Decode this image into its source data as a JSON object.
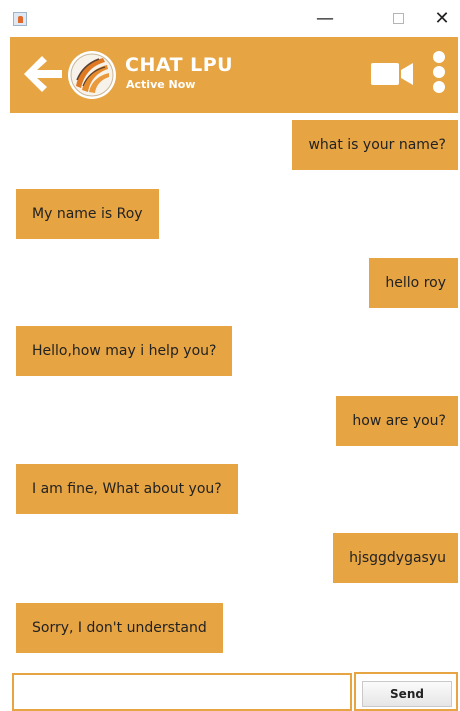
{
  "window": {
    "minimize_glyph": "—",
    "close_glyph": "✕"
  },
  "header": {
    "title": "CHAT LPU",
    "status": "Active Now",
    "background_color": "#e6a443",
    "icons": [
      "back-arrow-icon",
      "lpu-logo",
      "video-call-icon",
      "more-options-icon"
    ]
  },
  "messages": [
    {
      "direction": "sent",
      "text": "what is your name?"
    },
    {
      "direction": "received",
      "text": "My name is Roy"
    },
    {
      "direction": "sent",
      "text": "hello roy"
    },
    {
      "direction": "received",
      "text": "Hello,how may i help you?"
    },
    {
      "direction": "sent",
      "text": "how are you?"
    },
    {
      "direction": "received",
      "text": "I am fine, What about you?"
    },
    {
      "direction": "sent",
      "text": "hjsggdygasyu"
    },
    {
      "direction": "received",
      "text": "Sorry, I don't understand"
    }
  ],
  "composer": {
    "input_value": "",
    "send_label": "Send"
  }
}
